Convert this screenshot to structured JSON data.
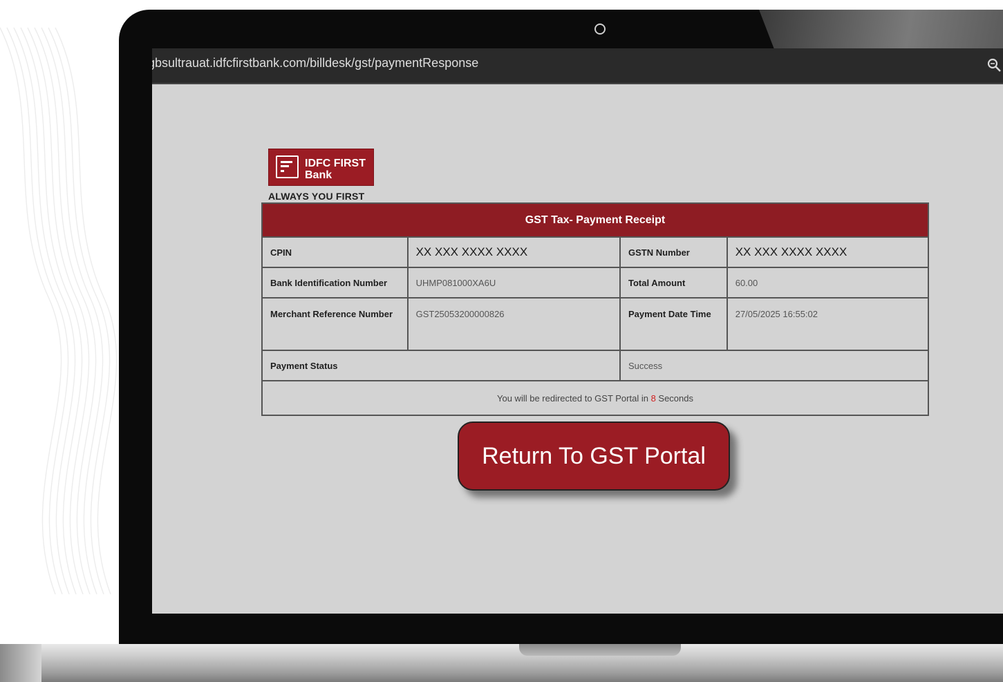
{
  "browser": {
    "url": "gbsultrauat.idfcfirstbank.com/billdesk/gst/paymentResponse",
    "zoom_icon": "zoom-icon"
  },
  "logo": {
    "line1": "IDFC FIRST",
    "line2": "Bank",
    "tagline": "ALWAYS YOU FIRST",
    "color": "#9b1c24"
  },
  "receipt": {
    "title": "GST Tax- Payment Receipt",
    "cpin_label": "CPIN",
    "cpin_value": "XX XXX XXXX XXXX",
    "gstn_label": "GSTN Number",
    "gstn_value": "XX XXX XXXX XXXX",
    "bin_label": "Bank Identification Number",
    "bin_value": "UHMP081000XA6U",
    "amount_label": "Total Amount",
    "amount_value": "60.00",
    "mref_label": "Merchant Reference Number",
    "mref_value": "GST25053200000826",
    "datetime_label": "Payment Date Time",
    "datetime_value": "27/05/2025 16:55:02",
    "status_label": "Payment Status",
    "status_value": "Success",
    "redirect_prefix": "You will be redirected to GST Portal in ",
    "redirect_count": "8",
    "redirect_suffix": " Seconds"
  },
  "return_button": "Return To GST Portal",
  "colors": {
    "header_bg": "#8e1c23",
    "countdown": "#d21f1f",
    "page_bg": "#d3d3d3"
  }
}
